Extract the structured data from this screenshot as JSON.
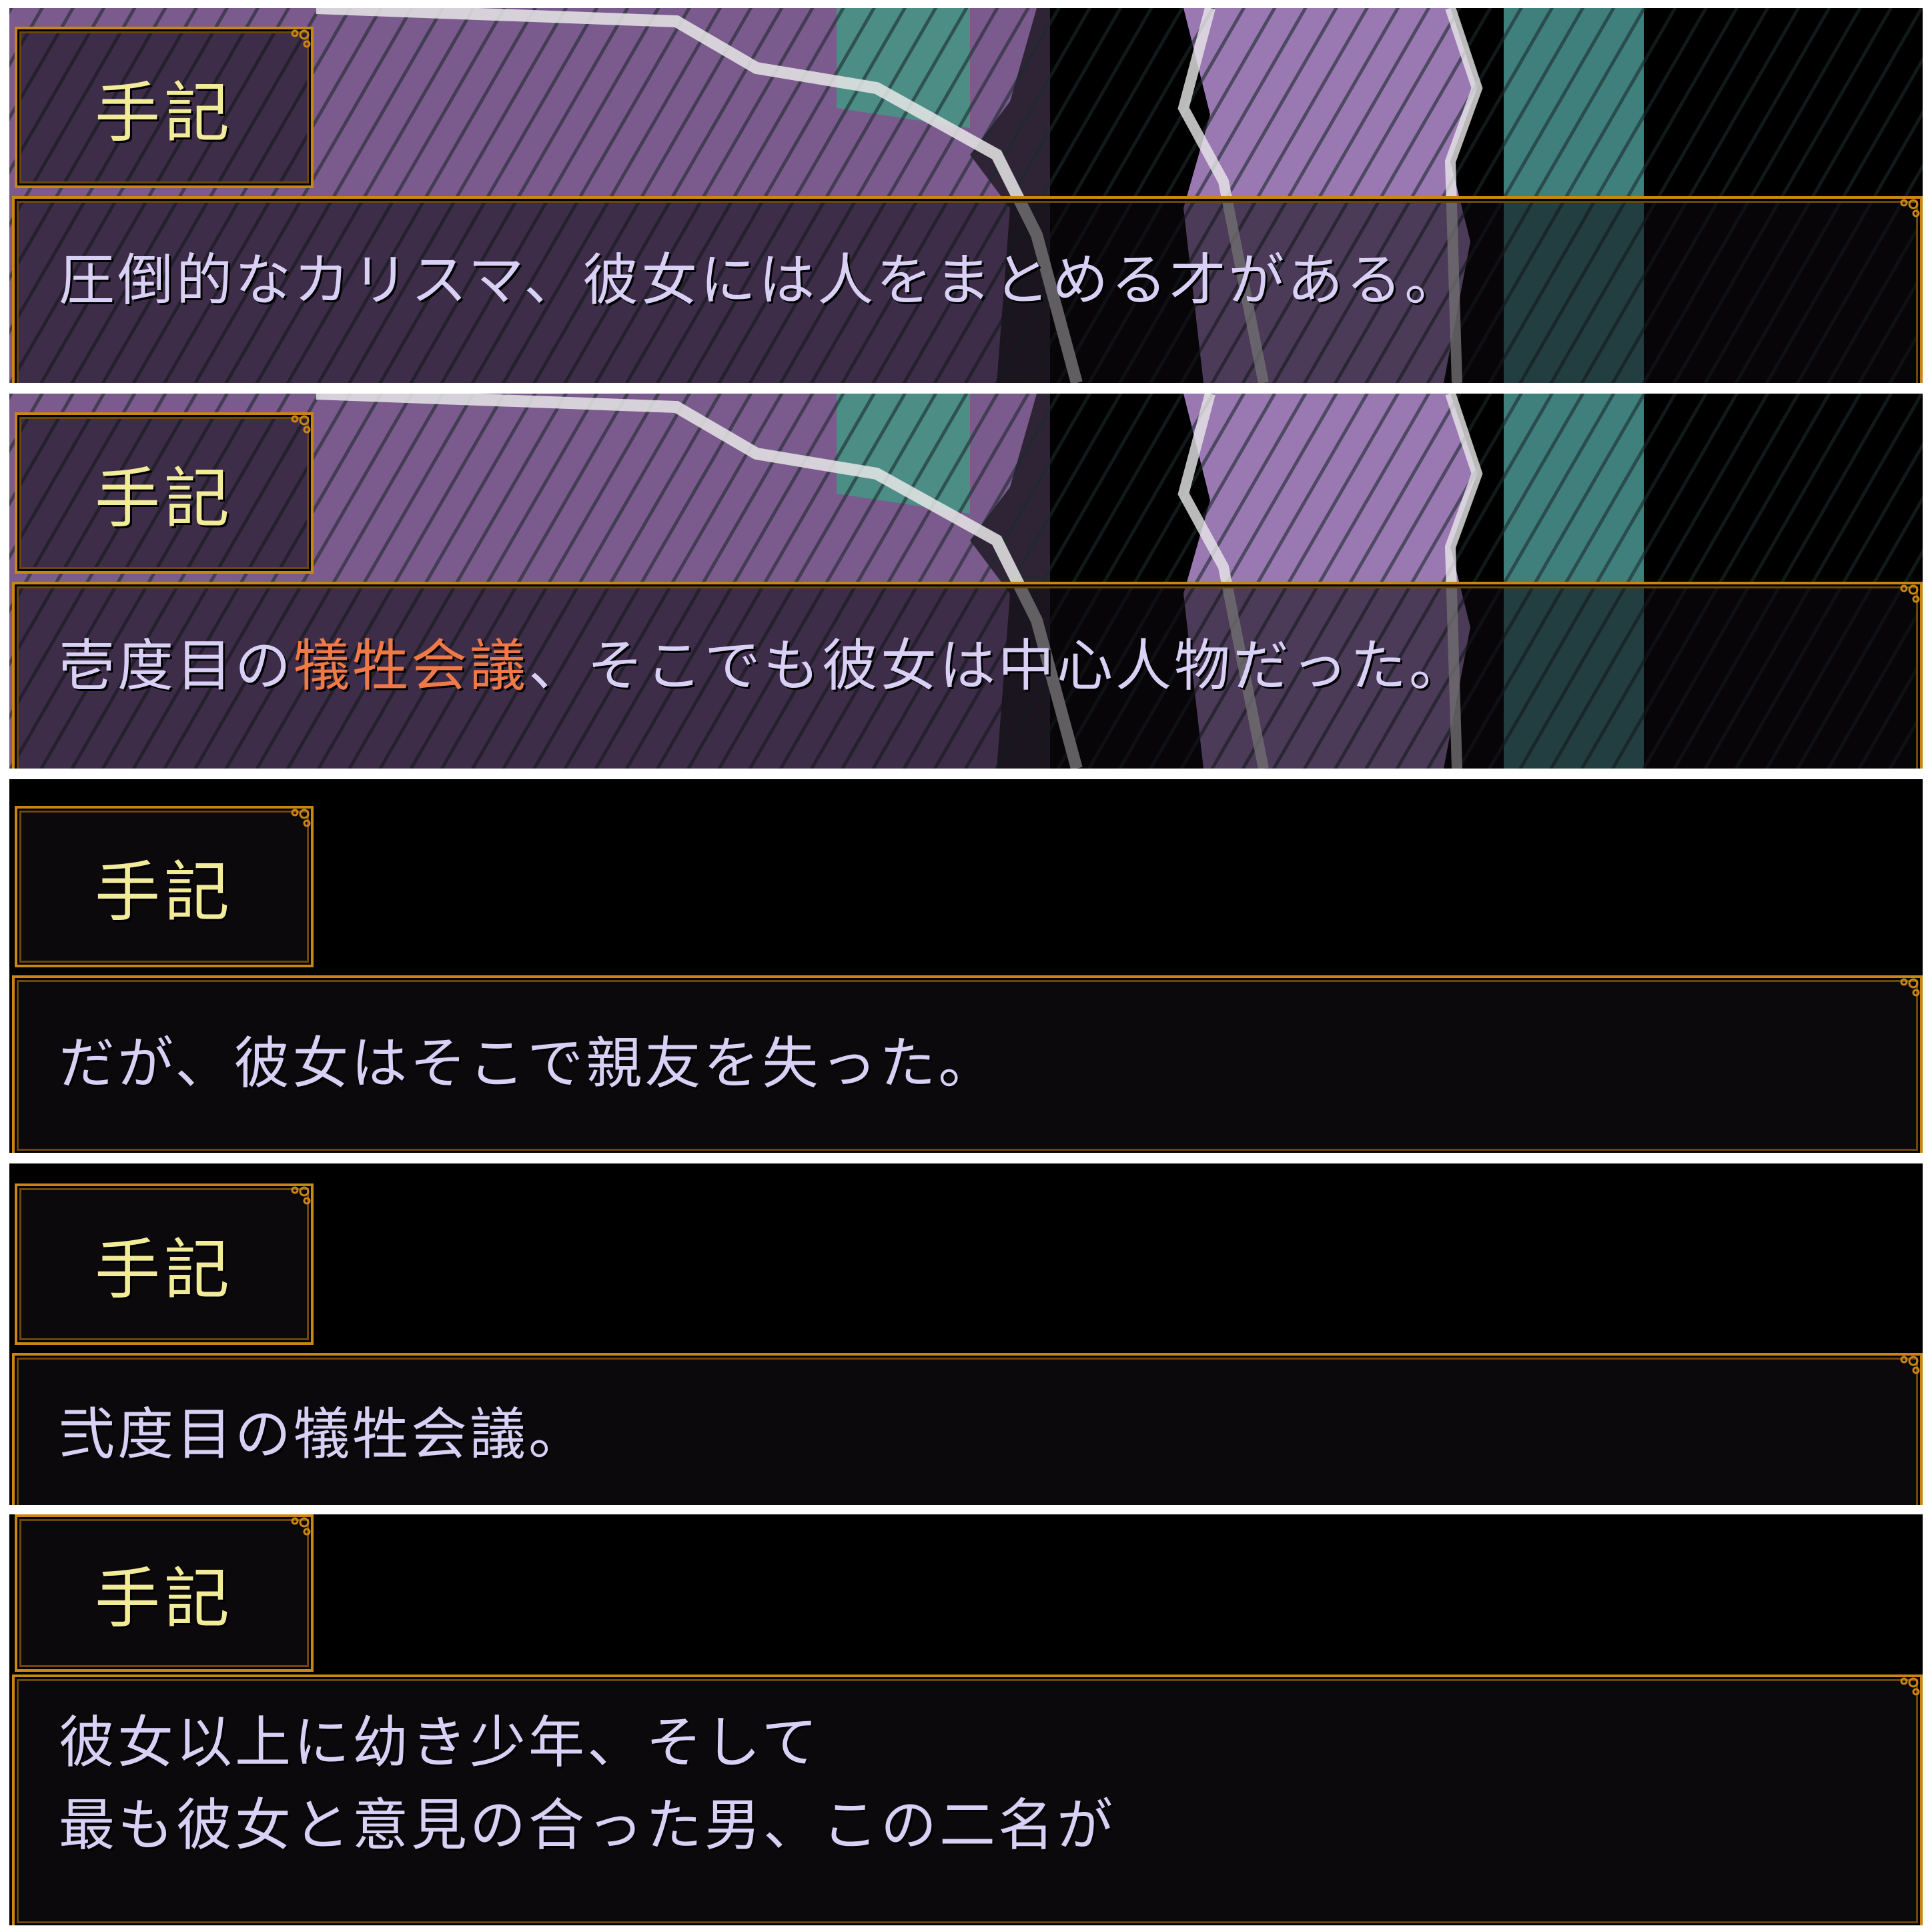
{
  "colors": {
    "frame": "#c98612",
    "name_text": "#f2ec9a",
    "dialogue_text": "#d9d0f5",
    "highlight_text": "#f07a47",
    "art_purple": "#8e6aa0",
    "art_teal": "#3f7f7c"
  },
  "panels": [
    {
      "speaker": "手記",
      "has_art": true,
      "lines": [
        "圧倒的なカリスマ、彼女には人をまとめる才がある。"
      ]
    },
    {
      "speaker": "手記",
      "has_art": true,
      "line_parts": {
        "before": "壱度目の",
        "highlight": "犠牲会議",
        "after": "、そこでも彼女は中心人物だった。"
      }
    },
    {
      "speaker": "手記",
      "has_art": false,
      "lines": [
        "だが、彼女はそこで親友を失った。"
      ]
    },
    {
      "speaker": "手記",
      "has_art": false,
      "lines": [
        "弐度目の犠牲会議。"
      ]
    },
    {
      "speaker": "手記",
      "has_art": false,
      "lines": [
        "彼女以上に幼き少年、そして",
        "最も彼女と意見の合った男、この二名が"
      ]
    }
  ]
}
